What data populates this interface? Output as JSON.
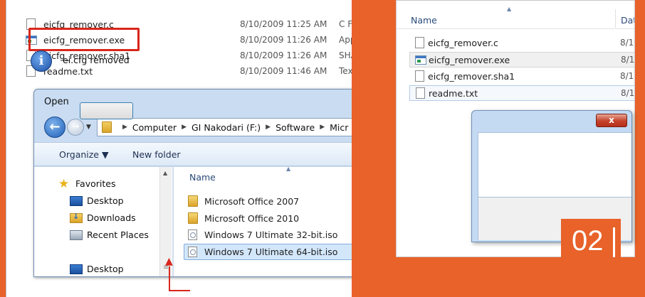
{
  "colors": {
    "background": "#e8622a",
    "highlight_border": "#d9261c",
    "selection": "#d3e7fb",
    "badge": "#e8622a"
  },
  "explorer_files": [
    {
      "name": "eicfg_remover.c",
      "date": "8/10/2009 11:25 AM",
      "type": "C Fi",
      "icon": "c-file-icon"
    },
    {
      "name": "eicfg_remover.exe",
      "date": "8/10/2009 11:26 AM",
      "type": "App",
      "icon": "exe-file-icon",
      "highlighted": true
    },
    {
      "name": "eicfg_remover.sha1",
      "date": "8/10/2009 11:26 AM",
      "type": "SHA",
      "icon": "sha1-file-icon"
    },
    {
      "name": "readme.txt",
      "date": "8/10/2009 11:46 AM",
      "type": "Tex",
      "icon": "txt-file-icon"
    }
  ],
  "open_dialog": {
    "title": "Open",
    "breadcrumb": [
      "Computer",
      "GI Nakodari (F:)",
      "Software",
      "Micr"
    ],
    "toolbar": {
      "organize_label": "Organize ▼",
      "new_folder_label": "New folder"
    },
    "nav_items": [
      {
        "label": "Favorites",
        "icon": "star-icon"
      },
      {
        "label": "Desktop",
        "icon": "desktop-icon"
      },
      {
        "label": "Downloads",
        "icon": "downloads-icon"
      },
      {
        "label": "Recent Places",
        "icon": "recent-places-icon"
      },
      {
        "label": "Desktop",
        "icon": "desktop-icon"
      }
    ],
    "file_header": "Name",
    "files": [
      {
        "name": "Microsoft Office 2007",
        "icon": "folder-icon"
      },
      {
        "name": "Microsoft Office 2010",
        "icon": "folder-icon"
      },
      {
        "name": "Windows 7 Ultimate 32-bit.iso",
        "icon": "iso-file-icon"
      },
      {
        "name": "Windows 7 Ultimate 64-bit.iso",
        "icon": "iso-file-icon",
        "selected": true
      }
    ]
  },
  "right_explorer": {
    "columns": {
      "name": "Name",
      "date": "Dat"
    },
    "files": [
      {
        "name": "eicfg_remover.c",
        "date": "8/1",
        "icon": "c-file-icon"
      },
      {
        "name": "eicfg_remover.exe",
        "date": "8/1",
        "icon": "exe-file-icon"
      },
      {
        "name": "eicfg_remover.sha1",
        "date": "8/1",
        "icon": "sha1-file-icon"
      },
      {
        "name": "readme.txt",
        "date": "8/1",
        "icon": "txt-file-icon"
      }
    ]
  },
  "message_box": {
    "close_label": "x",
    "message": "ei.cfg removed",
    "icon": "info-icon",
    "icon_glyph": "i"
  },
  "step_badge": "02"
}
